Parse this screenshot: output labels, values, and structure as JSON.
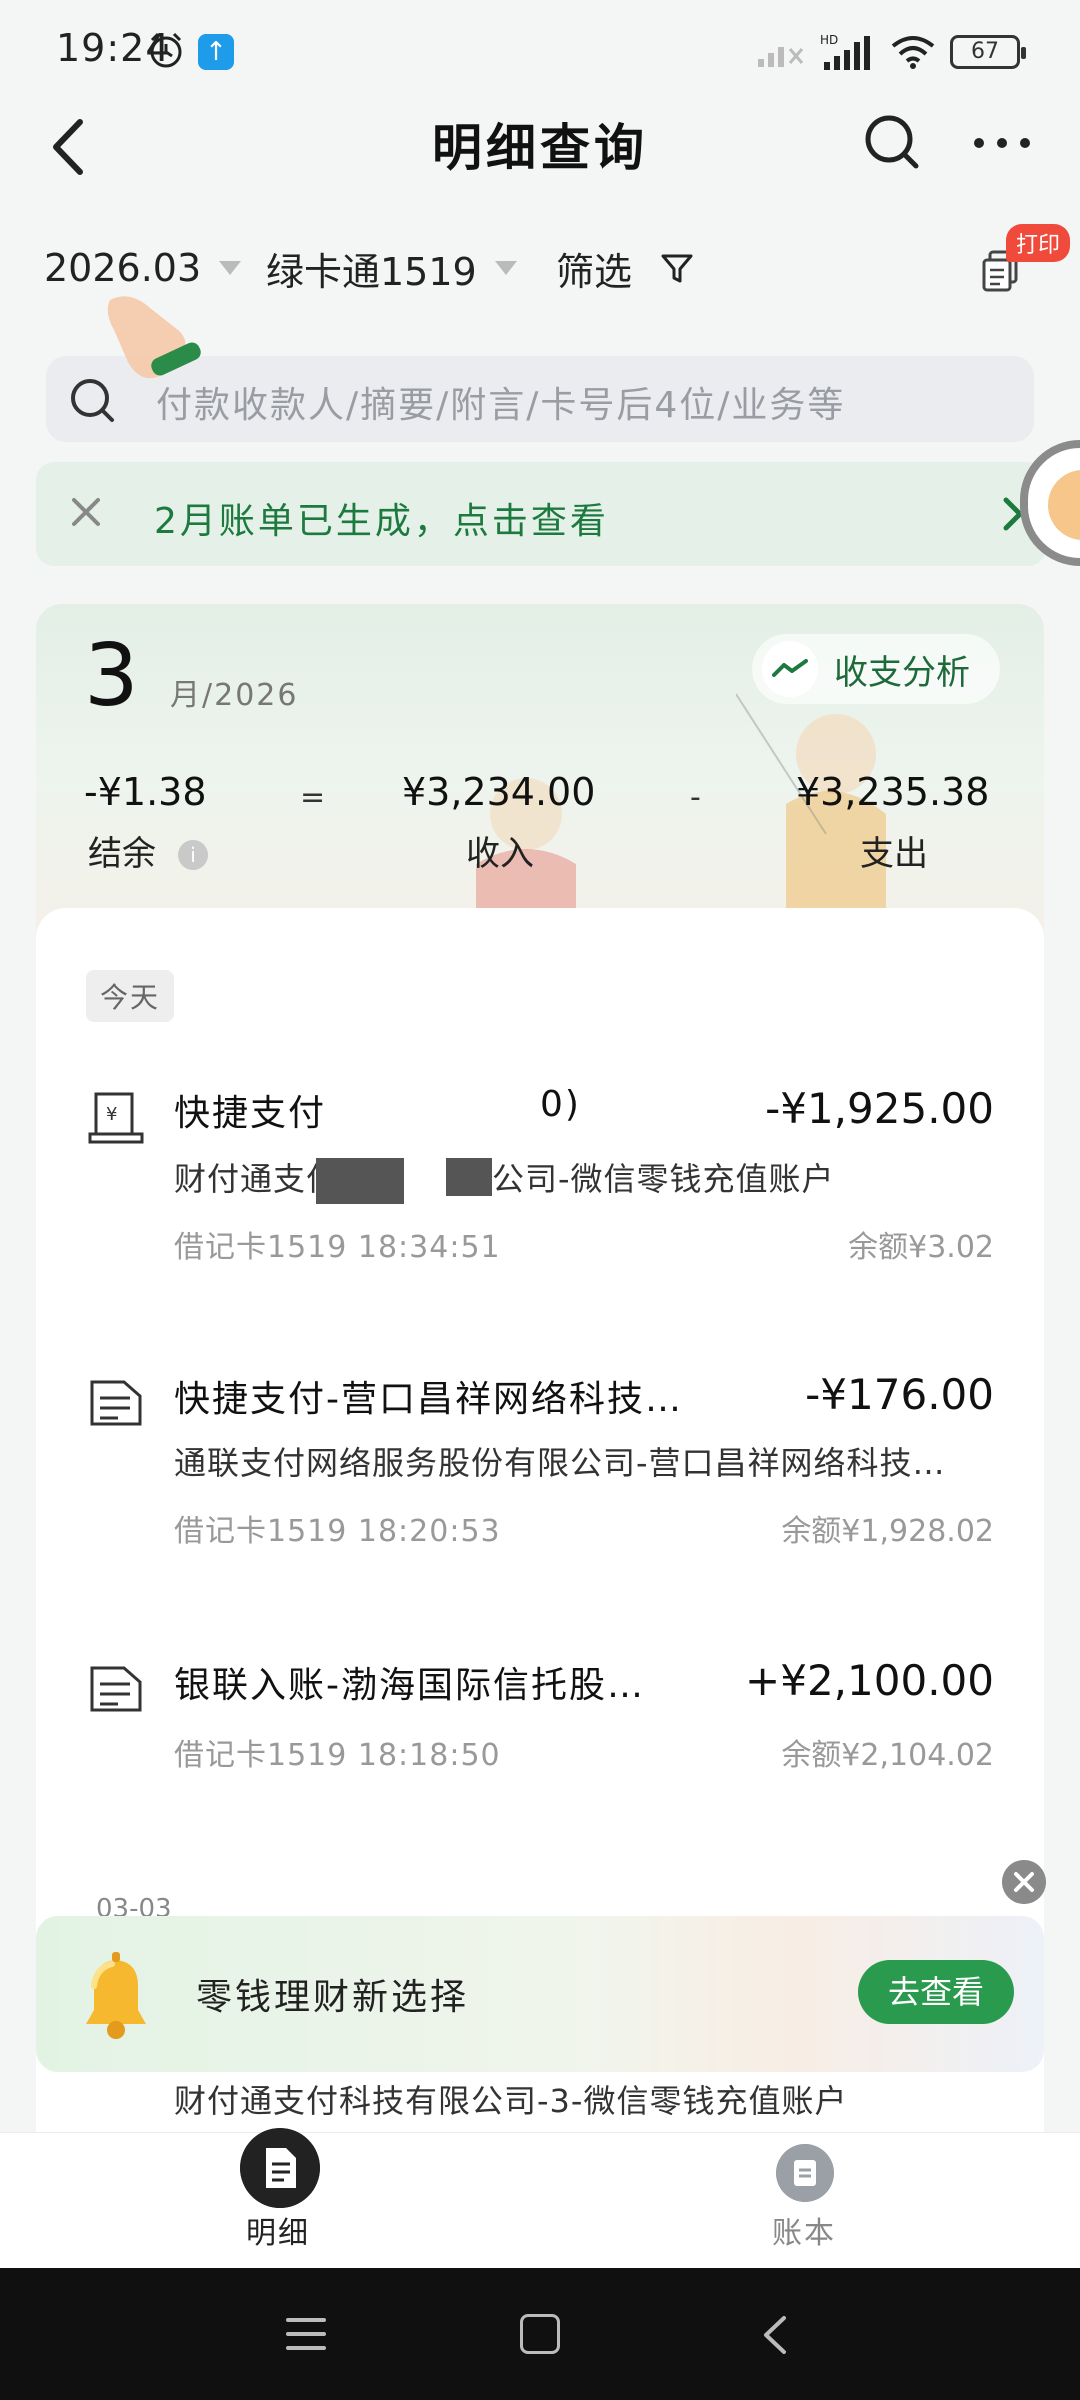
{
  "status_bar": {
    "time": "19:24",
    "battery": "67"
  },
  "header": {
    "title": "明细查询"
  },
  "filters": {
    "month": "2026.03",
    "card": "绿卡通1519",
    "filter_label": "筛选",
    "print_badge": "打印"
  },
  "search": {
    "placeholder": "付款收款人/摘要/附言/卡号后4位/业务等"
  },
  "notice": {
    "text": "2月账单已生成，点击查看"
  },
  "summary": {
    "month": "3",
    "year_label": "月/2026",
    "analysis_label": "收支分析",
    "balance": "-¥1.38",
    "eq": "=",
    "income": "¥3,234.00",
    "minus": "-",
    "expense": "¥3,235.38",
    "balance_label": "结余",
    "income_label": "收入",
    "expense_label": "支出"
  },
  "list": {
    "day_label": "今天",
    "transactions": [
      {
        "title": "快捷支付",
        "title_tail": "0)",
        "amount": "-¥1,925.00",
        "sub_head": "财付通支付",
        "sub_tail": "公司-微信零钱充值账户",
        "meta": "借记卡1519 18:34:51",
        "balance": "余额¥3.02"
      },
      {
        "title": "快捷支付-营口昌祥网络科技…",
        "amount": "-¥176.00",
        "sub": "通联支付网络服务股份有限公司-营口昌祥网络科技…",
        "meta": "借记卡1519 18:20:53",
        "balance": "余额¥1,928.02"
      },
      {
        "title": "银联入账-渤海国际信托股…",
        "amount": "+¥2,100.00",
        "meta": "借记卡1519 18:18:50",
        "balance": "余额¥2,104.02"
      }
    ],
    "next_date": "03-03",
    "under_text": "财付通支付科技有限公司-3-微信零钱充值账户"
  },
  "promo": {
    "text": "零钱理财新选择",
    "button": "去查看"
  },
  "tabs": [
    {
      "label": "明细"
    },
    {
      "label": "账本"
    }
  ],
  "colors": {
    "brand_green": "#2a9a4e",
    "notice_text": "#1d7a3e",
    "badge_red": "#f04a3c"
  }
}
